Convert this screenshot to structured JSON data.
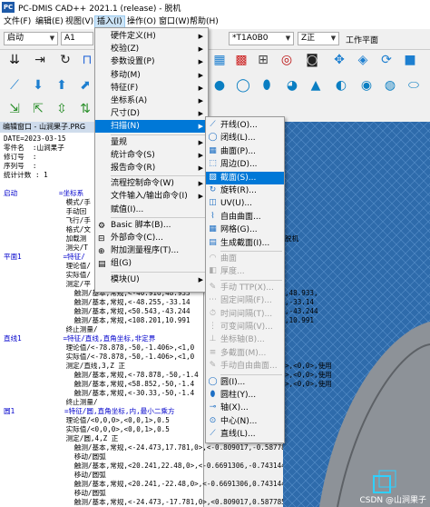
{
  "window": {
    "title": "PC-DMIS CAD++ 2021.1 (release) - 脱机",
    "app_icon": "PC"
  },
  "menubar": [
    {
      "label": "文件(F)"
    },
    {
      "label": "编辑(E)"
    },
    {
      "label": "视图(V)"
    },
    {
      "label": "插入(I)"
    },
    {
      "label": "操作(O)"
    },
    {
      "label": "窗口(W)"
    },
    {
      "label": "帮助(H)"
    }
  ],
  "comborow": {
    "mode": "启动",
    "alignment": "A1",
    "tip": "*T1A0B0",
    "view": "Z正",
    "workplane_label": "工作平面"
  },
  "insert_menu": [
    {
      "label": "硬件定义(H)",
      "sub": true
    },
    {
      "label": "校验(Z)",
      "sub": true
    },
    {
      "label": "参数设置(P)",
      "sub": true
    },
    {
      "label": "移动(M)",
      "sub": true
    },
    {
      "label": "特征(F)",
      "sub": true
    },
    {
      "label": "坐标系(A)",
      "sub": true
    },
    {
      "label": "尺寸(D)",
      "sub": true
    },
    {
      "label": "扫描(N)",
      "sub": true
    },
    {
      "label": "量规",
      "sub": true
    },
    {
      "label": "统计命令(S)",
      "sub": true
    },
    {
      "label": "报告命令(R)",
      "sub": true
    },
    {
      "label": "流程控制命令(W)",
      "sub": true
    },
    {
      "label": "文件输入/输出命令(I)",
      "sub": true
    },
    {
      "label": "赋值(I)...",
      "sub": false
    },
    {
      "label": "Basic 脚本(B)...",
      "sub": false
    },
    {
      "label": "外部命令(C)...",
      "sub": false
    },
    {
      "label": "附加测量程序(T)...",
      "sub": false
    },
    {
      "label": "组(G)",
      "sub": false
    },
    {
      "label": "模块(U)",
      "sub": true
    }
  ],
  "scan_menu": [
    {
      "label": "开线(O)...",
      "enabled": true
    },
    {
      "label": "闭线(L)...",
      "enabled": true
    },
    {
      "label": "曲面(P)...",
      "enabled": true
    },
    {
      "label": "周边(D)...",
      "enabled": true
    },
    {
      "label": "截面(S)...",
      "enabled": true
    },
    {
      "label": "旋转(R)...",
      "enabled": true
    },
    {
      "label": "UV(U)...",
      "enabled": true
    },
    {
      "label": "自由曲面...",
      "enabled": true
    },
    {
      "label": "网格(G)...",
      "enabled": true
    },
    {
      "label": "生成截面(I)...",
      "enabled": true
    },
    {
      "label": "曲面",
      "enabled": false
    },
    {
      "label": "厚度...",
      "enabled": false
    },
    {
      "label": "手动 TTP(X)...",
      "enabled": false
    },
    {
      "label": "固定间隔(F)...",
      "enabled": false
    },
    {
      "label": "时间间隔(T)...",
      "enabled": false
    },
    {
      "label": "可变间隔(V)...",
      "enabled": false
    },
    {
      "label": "坐标轴(B)...",
      "enabled": false
    },
    {
      "label": "多截面(M)...",
      "enabled": false
    },
    {
      "label": "手动自由曲面...",
      "enabled": false
    },
    {
      "label": "圆(I)...",
      "enabled": true
    },
    {
      "label": "圆柱(Y)...",
      "enabled": true
    },
    {
      "label": "轴(X)...",
      "enabled": true
    },
    {
      "label": "中心(N)...",
      "enabled": true
    },
    {
      "label": "直线(L)...",
      "enabled": true
    }
  ],
  "editor": {
    "title": "编辑窗口 - 山涧果子.PRG",
    "lines": [
      "DATE=2023-03-15",
      "零件名  :山涧果子",
      "修订号  :",
      "序列号  :",
      "统计计数 : 1",
      "",
      "启动          =坐标系",
      "               模式/手",
      "               手动回",
      "               飞行/手",
      "               格式/文",
      "               加载测",
      "               测尖/T",
      "平面1          =特征/",
      "               理论值/",
      "               实际值/",
      "               测定/平",
      "                 触测/基本,常规,<-40.916,48.933",
      "                 触测/基本,常规,<-48.255,-33.14",
      "                 触测/基本,常规,<50.543,-43.244",
      "                 触测/基本,常规,<108.201,10.991",
      "               终止测量/",
      "直线1          =特征/直线,直角坐标,非定界",
      "               理论值/<-78.878,-50,-1.406>,<1,0",
      "               实际值/<-78.878,-50,-1.406>,<1,0",
      "               测定/直线,3,Z 正",
      "                 触测/基本,常规,<-78.878,-50,-1.4",
      "                 触测/基本,常规,<58.852,-50,-1.4",
      "                 触测/基本,常规,<-30.33,-50,-1.4",
      "               终止测量/",
      "圆1            =特征/圆,直角坐标,内,最小二乘方",
      "               理论值/<0,0,0>,<0,0,1>,0.5",
      "               实际值/<0,0,0>,<0,0,1>,0.5",
      "               测定/圆,4,Z 正",
      "                 触测/基本,常规,<-24.473,17.781,0>,<-0.809017,-0.5877853,0",
      "                 移动/圆弧",
      "                 触测/基本,常规,<20.241,22.48,0>,<-0.6691306,-0.7431448,0",
      "                 移动/圆弧",
      "                 触测/基本,常规,<20.241,-22.48,0>,<-0.6691306,0.7431448,0",
      "                 移动/圆弧",
      "                 触测/基本,常规,<-24.473,-17.781,0>,<0.809017,0.5877853,0"
    ],
    "right_fragments": [
      ",48.933,",
      ",-33.14",
      ",-43.244",
      ",10.991",
      ">,<0,0>,使用",
      ">,<0,0>,使用",
      ">,<0,0>,使用"
    ],
    "right_note": "脱机"
  },
  "watermark": "CSDN @山涧果子",
  "colors": {
    "highlight": "#0078d7",
    "viewport": "#2f6fb0",
    "keyword": "#0000cc"
  }
}
